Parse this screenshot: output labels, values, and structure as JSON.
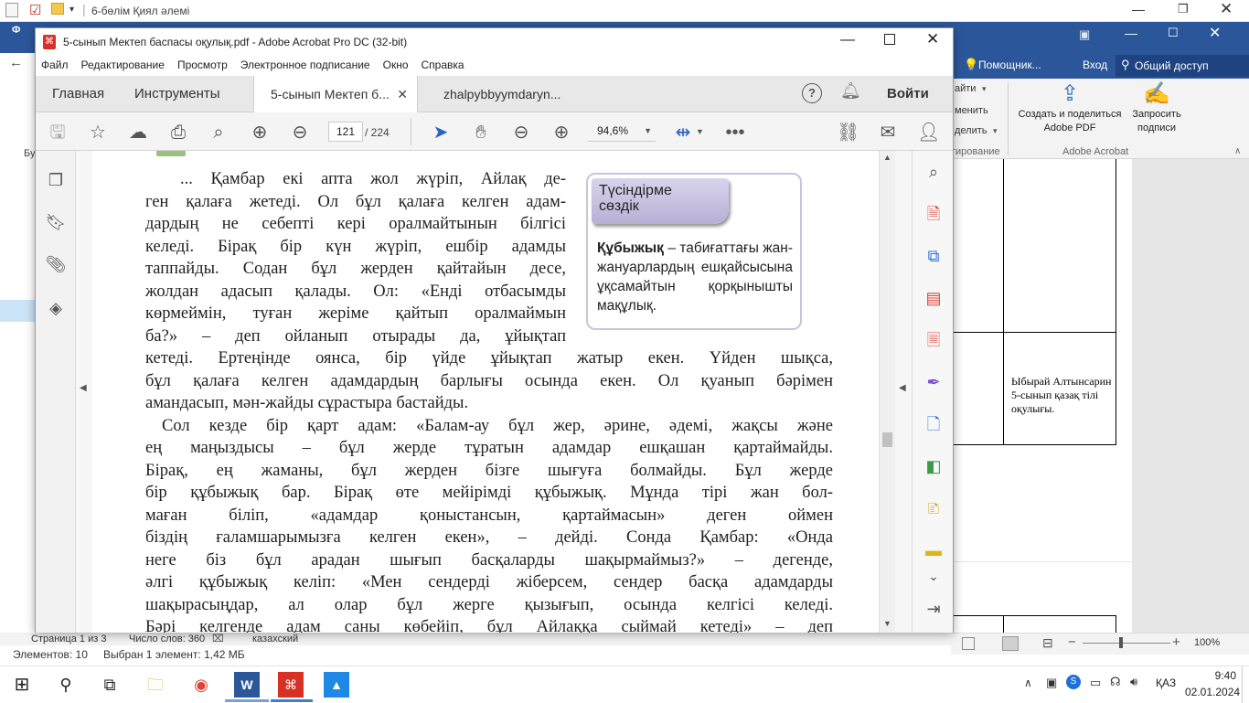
{
  "explorer": {
    "title": "6-бөлім Қиял әлемі",
    "status_items": "Элементов: 10",
    "status_selected": "Выбран 1 элемент: 1,42 МБ"
  },
  "word": {
    "tell_me": "Помощник...",
    "signin": "Вход",
    "share": "Общий доступ",
    "partial_menu1": "айти",
    "partial_menu2": "менить",
    "partial_menu3": "делить",
    "group_partial": "тирование",
    "create_share_label": "Создать и поделиться Adobe PDF",
    "request_sign_label": "Запросить подписи",
    "group_adobe": "Adobe Acrobat",
    "cell_text": "Ыбырай Алтынсарин 5-сынып қазақ тілі оқулығы.",
    "page_info": "Страница 1 из 3",
    "word_count": "Число слов: 360",
    "language": "казахский",
    "zoom": "100%",
    "side_letter": "Бу",
    "file_letter": "Ф"
  },
  "acrobat": {
    "title": "5-сынып Мектеп баспасы оқулық.pdf - Adobe Acrobat Pro DC (32-bit)",
    "menu": [
      "Файл",
      "Редактирование",
      "Просмотр",
      "Электронное подписание",
      "Окно",
      "Справка"
    ],
    "tabs": {
      "home": "Главная",
      "tools": "Инструменты",
      "doc1": "5-сынып Мектеп б...",
      "doc2": "zhalpybbyymdaryn...",
      "signin": "Войти"
    },
    "page_current": "121",
    "page_total": "/ 224",
    "zoom": "94,6%",
    "pdf": {
      "box_title": "Түсіндірме сөздік",
      "box_term": "Құбыжық",
      "box_def": " – табиғаттағы жан-жануарлардың ешқайсысына ұқсамайтын қорқынышты мақұлық.",
      "lines_narrow": [
        "... Қамбар екі апта жол жүріп, Айлақ де-",
        "ген қалаға жетеді. Ол бұл қалаға келген адам-",
        "дардың не себепті кері оралмайтынын білгісі",
        "келеді. Бірақ бір күн жүріп, ешбір адамды",
        "таппайды. Содан бұл жерден қайтайын десе,",
        "жолдан адасып қалады. Ол: «Енді отбасымды",
        "көрмеймін, туған жеріме қайтып оралмаймын",
        "ба?» – деп ойланып отырады да, ұйықтап"
      ],
      "lines_wide": [
        "кетеді. Ертеңінде оянса, бір үйде ұйықтап жатыр екен. Үйден шықса,",
        "бұл қалаға келген адамдардың барлығы осында екен. Ол қуанып бәрімен",
        "амандасып, мән-жайды сұрастыра бастайды.",
        "Сол кезде бір қарт адам: «Балам-ау бұл жер, әрине, әдемі, жақсы және",
        "ең маңыздысы – бұл жерде тұратын адамдар ешқашан қартаймайды.",
        "Бірақ, ең жаманы, бұл жерден бізге шығуға болмайды. Бұл жерде",
        "бір құбыжық бар. Бірақ өте мейірімді құбыжық. Мұнда тірі жан бол-",
        "маған біліп, «адамдар қоныстансын, қартаймасын» деген оймен",
        "біздің ғаламшарымызға келген екен», – дейді. Сонда Қамбар: «Онда",
        "неге біз бұл арадан шығып басқаларды шақырмаймыз?» – дегенде,",
        "әлгі құбыжық келіп: «Мен сендерді жіберсем, сендер басқа адамдарды",
        "шақырасыңдар, ал олар бұл жерге қызығып, осында келгісі келеді.",
        "Бәрі келгенде адам саны көбейіп, бұл Айлаққа сыймай кетеді» – деп"
      ]
    }
  },
  "taskbar": {
    "time": "9:40",
    "date": "02.01.2024",
    "lang": "ҚАЗ"
  }
}
